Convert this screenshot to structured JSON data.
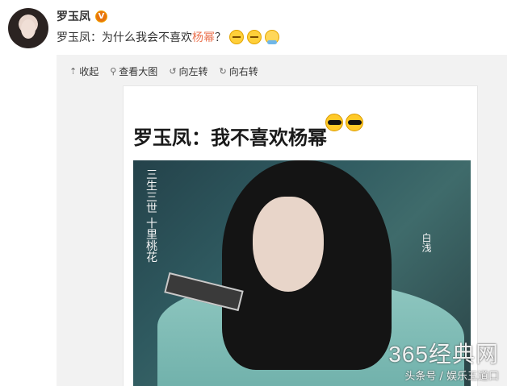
{
  "post": {
    "username": "罗玉凤",
    "badge": "V",
    "text_prefix": "罗玉凤：为什么我会不喜欢",
    "text_highlight": "杨幂",
    "text_suffix": "？",
    "emojis": [
      "cry-face",
      "cry-face",
      "hug-face"
    ]
  },
  "toolbar": {
    "collapse": "收起",
    "view_large": "查看大图",
    "rotate_left": "向左转",
    "rotate_right": "向右转"
  },
  "image": {
    "headline": "罗玉凤：我不喜欢杨幂",
    "calligraphy_left": "三生三世 十里桃花",
    "calligraphy_right": "白浅"
  },
  "watermark": {
    "line1": "365经典网",
    "line2": "头条号 / 娱乐五道口"
  }
}
